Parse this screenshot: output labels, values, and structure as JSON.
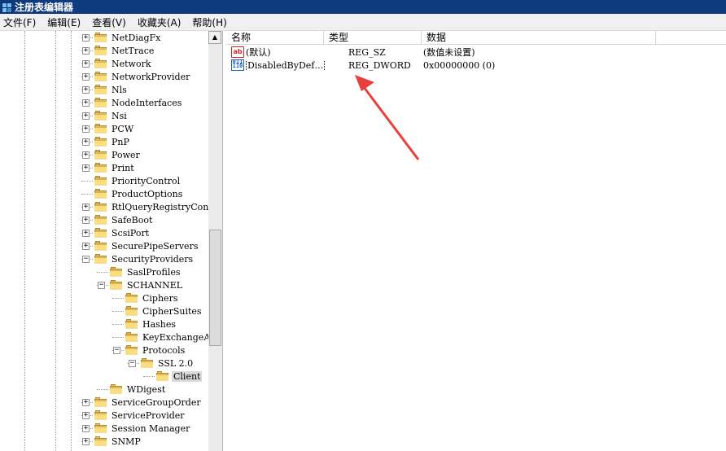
{
  "window": {
    "title": "注册表编辑器"
  },
  "menu": [
    "文件(F)",
    "编辑(E)",
    "查看(V)",
    "收藏夹(A)",
    "帮助(H)"
  ],
  "tree": {
    "nodes": [
      {
        "label": "NetDiagFx",
        "expander": "+",
        "level": 0
      },
      {
        "label": "NetTrace",
        "expander": "+",
        "level": 0
      },
      {
        "label": "Network",
        "expander": "+",
        "level": 0
      },
      {
        "label": "NetworkProvider",
        "expander": "+",
        "level": 0
      },
      {
        "label": "Nls",
        "expander": "+",
        "level": 0
      },
      {
        "label": "NodeInterfaces",
        "expander": "+",
        "level": 0
      },
      {
        "label": "Nsi",
        "expander": "+",
        "level": 0
      },
      {
        "label": "PCW",
        "expander": "+",
        "level": 0
      },
      {
        "label": "PnP",
        "expander": "+",
        "level": 0
      },
      {
        "label": "Power",
        "expander": "+",
        "level": 0
      },
      {
        "label": "Print",
        "expander": "+",
        "level": 0
      },
      {
        "label": "PriorityControl",
        "expander": "",
        "level": 0
      },
      {
        "label": "ProductOptions",
        "expander": "",
        "level": 0
      },
      {
        "label": "RtlQueryRegistryConf",
        "expander": "+",
        "level": 0
      },
      {
        "label": "SafeBoot",
        "expander": "+",
        "level": 0
      },
      {
        "label": "ScsiPort",
        "expander": "+",
        "level": 0
      },
      {
        "label": "SecurePipeServers",
        "expander": "+",
        "level": 0
      },
      {
        "label": "SecurityProviders",
        "expander": "−",
        "level": 0
      },
      {
        "label": "SaslProfiles",
        "expander": "",
        "level": 1
      },
      {
        "label": "SCHANNEL",
        "expander": "−",
        "level": 1
      },
      {
        "label": "Ciphers",
        "expander": "",
        "level": 2
      },
      {
        "label": "CipherSuites",
        "expander": "",
        "level": 2
      },
      {
        "label": "Hashes",
        "expander": "",
        "level": 2
      },
      {
        "label": "KeyExchangeAlg",
        "expander": "",
        "level": 2
      },
      {
        "label": "Protocols",
        "expander": "−",
        "level": 2
      },
      {
        "label": "SSL 2.0",
        "expander": "−",
        "level": 3
      },
      {
        "label": "Client",
        "expander": "",
        "level": 4,
        "selected": true
      },
      {
        "label": "WDigest",
        "expander": "",
        "level": 1
      },
      {
        "label": "ServiceGroupOrder",
        "expander": "+",
        "level": 0
      },
      {
        "label": "ServiceProvider",
        "expander": "+",
        "level": 0
      },
      {
        "label": "Session Manager",
        "expander": "+",
        "level": 0
      },
      {
        "label": "SNMP",
        "expander": "+",
        "level": 0
      }
    ]
  },
  "list": {
    "columns": [
      "名称",
      "类型",
      "数据"
    ],
    "rows": [
      {
        "name": "(默认)",
        "type": "REG_SZ",
        "data": "(数值未设置)",
        "icon": "string-value-icon",
        "icon_text": "ab"
      },
      {
        "name": "DisabledByDef…",
        "type": "REG_DWORD",
        "data": "0x00000000 (0)",
        "icon": "binary-value-icon",
        "icon_text": "011\n110"
      }
    ]
  },
  "annotation": {
    "color": "#e8413c"
  }
}
